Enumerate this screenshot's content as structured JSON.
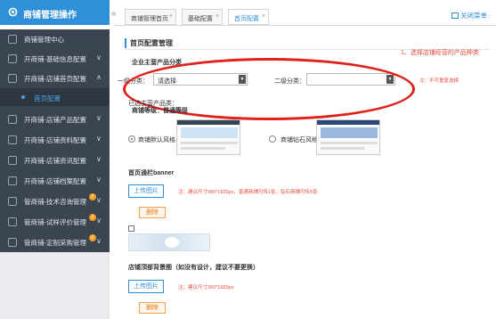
{
  "sidebar": {
    "header_title": "商铺管理操作",
    "items": [
      {
        "label": "商铺管理中心",
        "chevron": ""
      },
      {
        "label": "开商铺-基础信息配置",
        "chevron": "∨"
      },
      {
        "label": "开商铺-店铺首页配置",
        "chevron": "∧"
      },
      {
        "label": "开商铺-店铺产品配置",
        "chevron": "∨"
      },
      {
        "label": "开商铺-店铺资料配置",
        "chevron": "∨"
      },
      {
        "label": "开商铺-店铺资讯配置",
        "chevron": "∨"
      },
      {
        "label": "开商铺-店铺档案配置",
        "chevron": "∨"
      },
      {
        "label": "管商铺-技术咨询管理",
        "chevron": "∨",
        "badge": "0"
      },
      {
        "label": "管商铺-试样评价管理",
        "chevron": "∨",
        "badge": "0"
      },
      {
        "label": "管商铺-定制采购管理",
        "chevron": "∨",
        "badge": "0"
      }
    ],
    "sub_item": "首页配置"
  },
  "topbar": {
    "collapse": "«",
    "tabs": [
      {
        "label": "商铺管理首页",
        "close": "×"
      },
      {
        "label": "基础配置",
        "close": "×"
      },
      {
        "label": "首页配置",
        "close": "×"
      }
    ],
    "close_all": "关闭菜单"
  },
  "content": {
    "section_title": "首页配置管理",
    "annotation": "1、选择店铺经营的产品种类",
    "enterprise_category_label": "企业主营产品分类",
    "level1_label": "一级分类：",
    "level1_value": "请选择",
    "level2_label": "二级分类：",
    "level2_value": "",
    "select_note": "注：不可重复选择",
    "selected_category_label": "已选主营产品类：",
    "shop_level_label": "商铺等级：普通等级",
    "style_default_label": "商铺默认风格",
    "style_diamond_label": "商铺钻石风格",
    "banner_title": "首页通栏banner",
    "upload_label": "上传图片",
    "banner_note": "注：建议尺寸980*1920px，普通商铺可传1张，钻石商铺可传5张",
    "delete_label": "删除",
    "topbg_title": "店铺顶部背景图（如没有设计，建议不要更换）",
    "upload_label_2": "上传图片",
    "topbg_note": "注：建议尺寸300*1920px",
    "delete_label_2": "删除"
  },
  "colors": {
    "accent": "#2f8fd8",
    "sidebar_bg": "#3b4552",
    "annotation_red": "#e0201b",
    "badge": "#f29b1f"
  }
}
